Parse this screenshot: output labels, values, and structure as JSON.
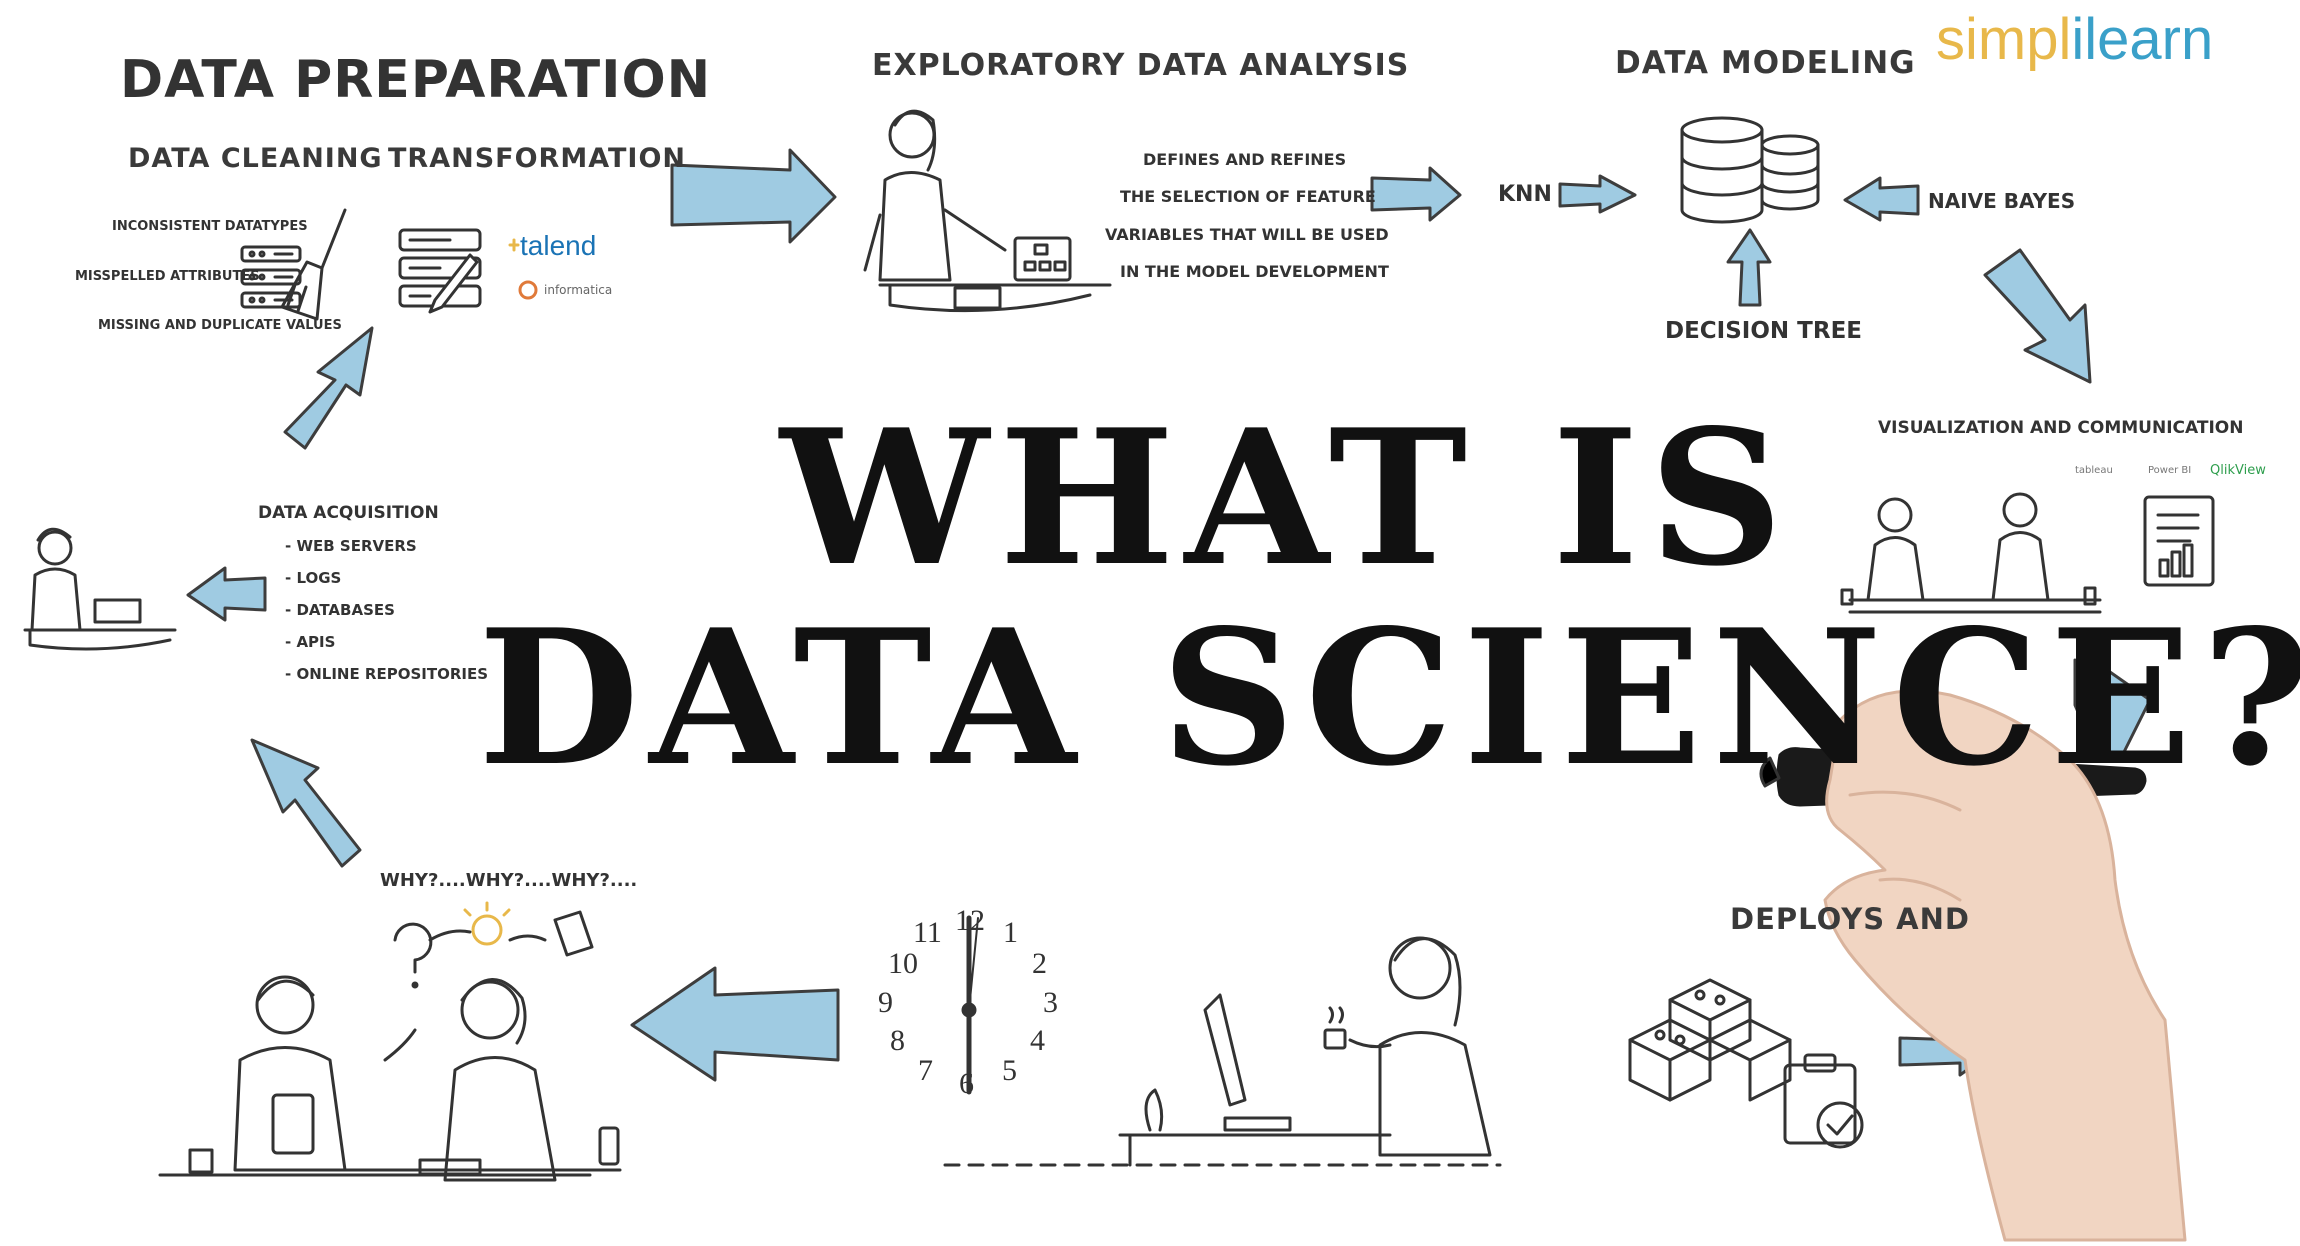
{
  "logo": {
    "part1": "simpl",
    "part2": "ilearn"
  },
  "headline": {
    "line1": "WHAT IS",
    "line2": "DATA SCIENCE?"
  },
  "data_preparation": {
    "title": "DATA PREPARATION",
    "cleaning": {
      "title": "DATA CLEANING",
      "items": [
        "INCONSISTENT DATATYPES",
        "MISSPELLED ATTRIBUTES",
        "MISSING AND DUPLICATE VALUES"
      ]
    },
    "transformation": {
      "title": "TRANSFORMATION",
      "tools": [
        "talend",
        "informatica"
      ]
    }
  },
  "eda": {
    "title": "EXPLORATORY DATA ANALYSIS",
    "lines": [
      "DEFINES AND REFINES",
      "THE SELECTION OF FEATURE",
      "VARIABLES THAT WILL BE USED",
      "IN THE MODEL DEVELOPMENT"
    ]
  },
  "modeling": {
    "title": "DATA MODELING",
    "knn": "KNN",
    "naive_bayes": "NAIVE BAYES",
    "decision_tree": "DECISION TREE"
  },
  "visualization": {
    "title": "VISUALIZATION AND COMMUNICATION",
    "tools": [
      "tableau",
      "Power BI",
      "QlikView"
    ]
  },
  "acquisition": {
    "title": "DATA ACQUISITION",
    "sources": [
      "WEB SERVERS",
      "LOGS",
      "DATABASES",
      "APIS",
      "ONLINE REPOSITORIES"
    ]
  },
  "why": {
    "text": "WHY?....WHY?....WHY?...."
  },
  "deploys": {
    "title": "DEPLOYS AND"
  },
  "clock": {
    "numbers": [
      "12",
      "1",
      "2",
      "3",
      "4",
      "5",
      "6",
      "7",
      "8",
      "9",
      "10",
      "11"
    ]
  },
  "colors": {
    "arrow_fill": "#9fcbe2",
    "arrow_stroke": "#3d3d3d",
    "ink": "#2f2f2f"
  }
}
